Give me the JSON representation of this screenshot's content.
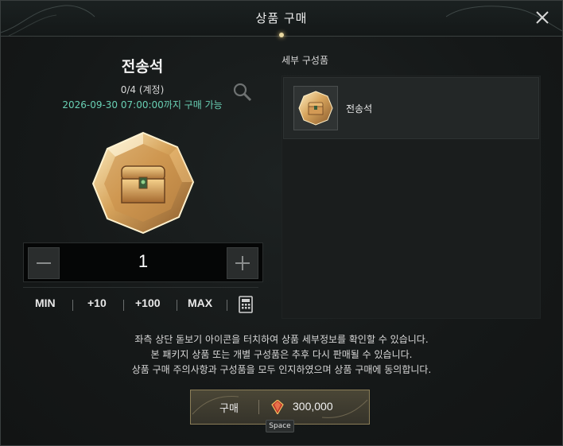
{
  "dialog": {
    "title": "상품 구매",
    "close_icon": "close-icon"
  },
  "product": {
    "name": "전송석",
    "limit": "0/4 (계정)",
    "deadline": "2026-09-30 07:00:00까지 구매 가능",
    "image_icon": "treasure-chest-gem-icon"
  },
  "quantity": {
    "value": "1",
    "minus_icon": "minus-icon",
    "plus_icon": "plus-icon",
    "quick": [
      "MIN",
      "+10",
      "+100",
      "MAX"
    ],
    "calculator_icon": "calculator-icon"
  },
  "details": {
    "title": "세부 구성품",
    "items": [
      {
        "name": "전송석",
        "icon": "treasure-chest-gem-icon"
      }
    ]
  },
  "notices": [
    "좌측 상단 돋보기 아이콘을 터치하여 상품 세부정보를 확인할 수 있습니다.",
    "본 패키지 상품 또는 개별 구성품은 추후 다시 판매될 수 있습니다.",
    "상품 구매 주의사항과 구성품을 모두 인지하였으며 상품 구매에 동의합니다."
  ],
  "purchase": {
    "label": "구매",
    "currency_icon": "red-gem-icon",
    "price": "300,000",
    "hotkey": "Space"
  },
  "colors": {
    "accent_teal": "#69d0b4",
    "gold_border": "#8c7f58"
  }
}
